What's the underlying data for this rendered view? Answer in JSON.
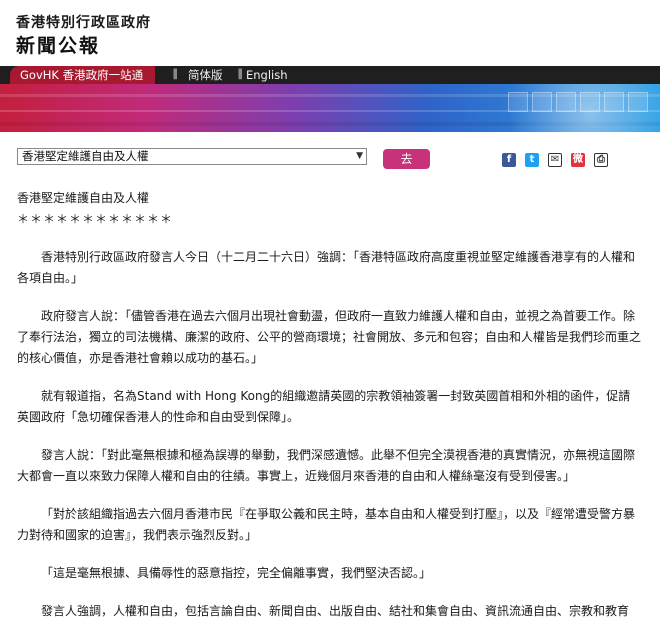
{
  "header": {
    "subtitle": "香港特別行政區政府",
    "title": "新聞公報"
  },
  "nav": {
    "govhk": "GovHK 香港政府一站通",
    "simplified": "简体版",
    "english": "English"
  },
  "toolbar": {
    "select_value": "香港堅定維護自由及人權",
    "go_label": "去"
  },
  "share": {
    "icons": [
      "facebook-icon",
      "twitter-icon",
      "email-icon",
      "weibo-icon",
      "print-icon"
    ]
  },
  "article": {
    "title": "香港堅定維護自由及人權",
    "stars": "＊＊＊＊＊＊＊＊＊＊＊＊",
    "p1": "香港特別行政區政府發言人今日（十二月二十六日）強調：「香港特區政府高度重視並堅定維護香港享有的人權和各項自由。」",
    "p2": "政府發言人說：「儘管香港在過去六個月出現社會動盪，但政府一直致力維護人權和自由，並視之為首要工作。除了奉行法治，獨立的司法機構、廉潔的政府、公平的營商環境；社會開放、多元和包容；自由和人權皆是我們珍而重之的核心價值，亦是香港社會賴以成功的基石。」",
    "p3": "就有報道指，名為Stand with Hong Kong的組織邀請英國的宗教領袖簽署一封致英國首相和外相的函件，促請英國政府「急切確保香港人的性命和自由受到保障」。",
    "p4": "發言人說：「對此毫無根據和極為誤導的舉動，我們深感遺憾。此舉不但完全漠視香港的真實情況，亦無視這國際大都會一直以來致力保障人權和自由的往績。事實上，近幾個月來香港的自由和人權絲毫沒有受到侵害。」",
    "p5": "「對於該組織指過去六個月香港市民『在爭取公義和民主時，基本自由和人權受到打壓』，以及『經常遭受警方暴力對待和國家的迫害』，我們表示強烈反對。」",
    "p6": "「這是毫無根據、具備辱性的惡意指控，完全偏離事實，我們堅決否認。」",
    "p7": "發言人強調，人權和自由，包括言論自由、新聞自由、出版自由、結社和集會自由、資訊流通自由、宗教和教育"
  }
}
